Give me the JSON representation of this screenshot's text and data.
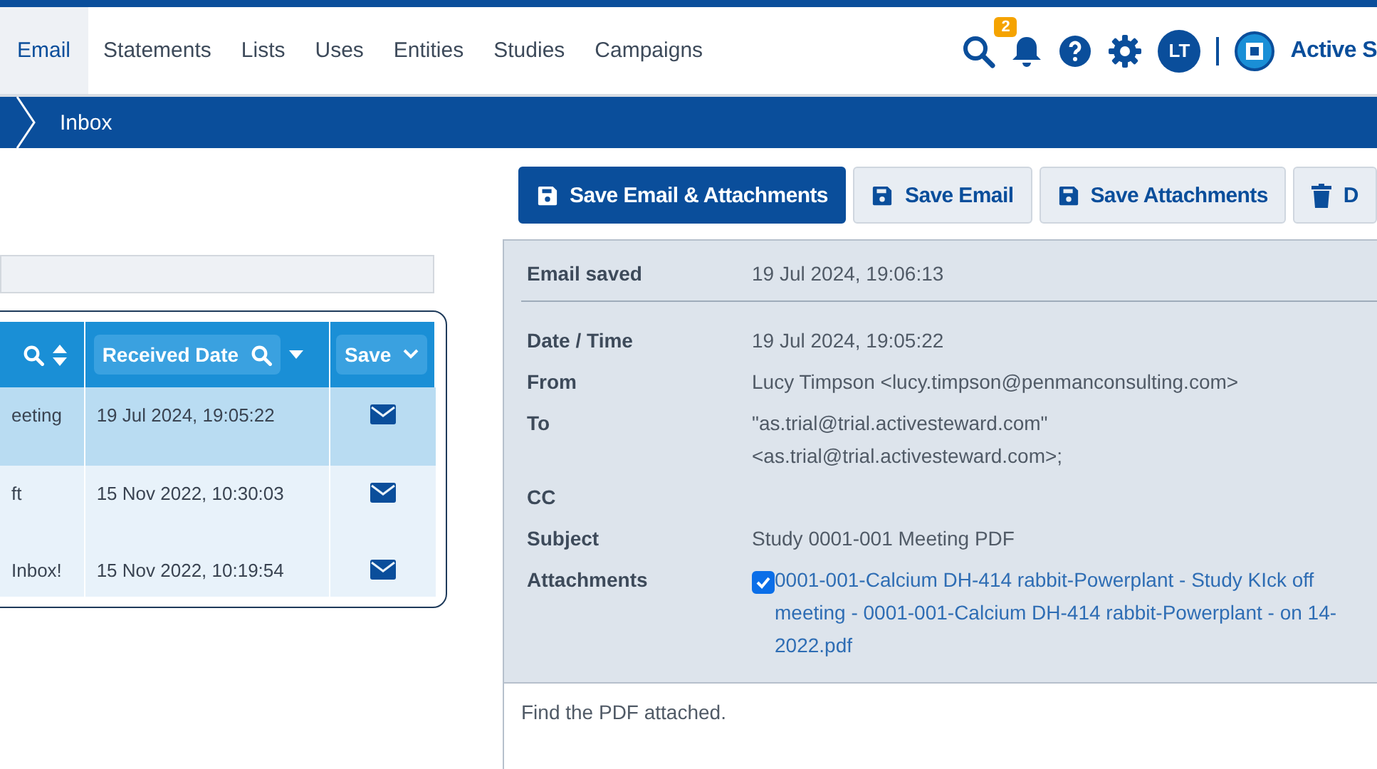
{
  "nav": {
    "tabs": [
      {
        "label": "Email",
        "selected": true
      },
      {
        "label": "Statements",
        "selected": false
      },
      {
        "label": "Lists",
        "selected": false
      },
      {
        "label": "Uses",
        "selected": false
      },
      {
        "label": "Entities",
        "selected": false
      },
      {
        "label": "Studies",
        "selected": false
      },
      {
        "label": "Campaigns",
        "selected": false
      }
    ],
    "notification_count": "2",
    "avatar": "LT",
    "brand": "Active S"
  },
  "breadcrumb": "Inbox",
  "table": {
    "columns": [
      {
        "label": "Received Date",
        "kind": "search"
      },
      {
        "label": "Save",
        "kind": "dropdown"
      }
    ],
    "rows": [
      {
        "column_1": "eeting",
        "received_date": "19 Jul 2024, 19:05:22",
        "selected": true
      },
      {
        "column_1": "ft",
        "received_date": "15 Nov 2022, 10:30:03",
        "selected": false
      },
      {
        "column_1": "Inbox!",
        "received_date": "15 Nov 2022, 10:19:54",
        "selected": false
      }
    ]
  },
  "toolbar": [
    {
      "label": "Save Email & Attachments",
      "kind": "primary"
    },
    {
      "label": "Save Email",
      "kind": "secondary"
    },
    {
      "label": "Save Attachments",
      "kind": "secondary"
    },
    {
      "label": "D",
      "kind": "delete"
    }
  ],
  "email_saved": {
    "label": "Email saved",
    "value": "19 Jul 2024, 19:06:13"
  },
  "fields": [
    {
      "label": "Date / Time",
      "lines": [
        "19 Jul 2024, 19:05:22"
      ]
    },
    {
      "label": "From",
      "lines": [
        "Lucy Timpson <lucy.timpson@penmanconsulting.com>"
      ]
    },
    {
      "label": "To",
      "lines": [
        "\"as.trial@trial.activesteward.com\"",
        "<as.trial@trial.activesteward.com>;"
      ]
    },
    {
      "label": "CC"
    },
    {
      "label": "Subject",
      "lines": [
        "Study 0001-001 Meeting PDF"
      ]
    }
  ],
  "attachments": {
    "label": "Attachments",
    "checked": true,
    "lines": [
      "0001-001-Calcium DH-414 rabbit-Powerplant - Study KIck off",
      "meeting - 0001-001-Calcium DH-414 rabbit-Powerplant - on 14-",
      "2022.pdf"
    ]
  },
  "body": "Find the PDF attached."
}
